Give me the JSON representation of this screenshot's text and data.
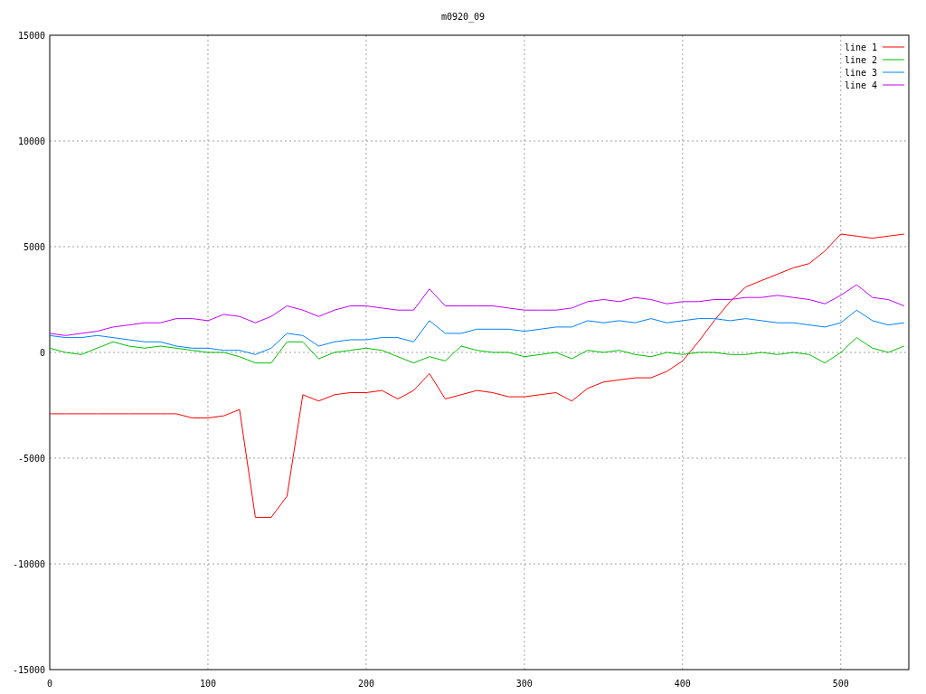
{
  "chart_data": {
    "type": "line",
    "title": "m0920_09",
    "x": [
      0,
      10,
      20,
      30,
      40,
      50,
      60,
      70,
      80,
      90,
      100,
      110,
      120,
      130,
      140,
      150,
      160,
      170,
      180,
      190,
      200,
      210,
      220,
      230,
      240,
      250,
      260,
      270,
      280,
      290,
      300,
      310,
      320,
      330,
      340,
      350,
      360,
      370,
      380,
      390,
      400,
      410,
      420,
      430,
      440,
      450,
      460,
      470,
      480,
      490,
      500,
      510,
      520,
      530,
      540
    ],
    "series": [
      {
        "name": "line 1",
        "color": "#ff0000",
        "values": [
          -2900,
          -2900,
          -2900,
          -2900,
          -2900,
          -2900,
          -2900,
          -2900,
          -2900,
          -3100,
          -3100,
          -3000,
          -2700,
          -7800,
          -7800,
          -6800,
          -2000,
          -2300,
          -2000,
          -1900,
          -1900,
          -1800,
          -2200,
          -1800,
          -1000,
          -2200,
          -2000,
          -1800,
          -1900,
          -2100,
          -2100,
          -2000,
          -1900,
          -2300,
          -1700,
          -1400,
          -1300,
          -1200,
          -1200,
          -900,
          -400,
          500,
          1500,
          2400,
          3100,
          3400,
          3700,
          4000,
          4200,
          4800,
          5600,
          5500,
          5400,
          5500,
          5600
        ]
      },
      {
        "name": "line 2",
        "color": "#00c000",
        "values": [
          200,
          0,
          -100,
          200,
          500,
          300,
          200,
          300,
          200,
          100,
          0,
          0,
          -200,
          -500,
          -500,
          500,
          500,
          -300,
          0,
          100,
          200,
          100,
          -200,
          -500,
          -200,
          -400,
          300,
          100,
          0,
          0,
          -200,
          -100,
          0,
          -300,
          100,
          0,
          100,
          -100,
          -200,
          0,
          -100,
          0,
          0,
          -100,
          -100,
          0,
          -100,
          0,
          -100,
          -500,
          0,
          700,
          200,
          0,
          300
        ]
      },
      {
        "name": "line 3",
        "color": "#0080ff",
        "values": [
          800,
          700,
          700,
          800,
          700,
          600,
          500,
          500,
          300,
          200,
          200,
          100,
          100,
          -100,
          200,
          900,
          800,
          300,
          500,
          600,
          600,
          700,
          700,
          500,
          1500,
          900,
          900,
          1100,
          1100,
          1100,
          1000,
          1100,
          1200,
          1200,
          1500,
          1400,
          1500,
          1400,
          1600,
          1400,
          1500,
          1600,
          1600,
          1500,
          1600,
          1500,
          1400,
          1400,
          1300,
          1200,
          1400,
          2000,
          1500,
          1300,
          1400
        ]
      },
      {
        "name": "line 4",
        "color": "#c000ff",
        "values": [
          900,
          800,
          900,
          1000,
          1200,
          1300,
          1400,
          1400,
          1600,
          1600,
          1500,
          1800,
          1700,
          1400,
          1700,
          2200,
          2000,
          1700,
          2000,
          2200,
          2200,
          2100,
          2000,
          2000,
          3000,
          2200,
          2200,
          2200,
          2200,
          2100,
          2000,
          2000,
          2000,
          2100,
          2400,
          2500,
          2400,
          2600,
          2500,
          2300,
          2400,
          2400,
          2500,
          2500,
          2600,
          2600,
          2700,
          2600,
          2500,
          2300,
          2700,
          3200,
          2600,
          2500,
          2200
        ]
      }
    ],
    "grid": true,
    "legend": true,
    "xlim": [
      0,
      543
    ],
    "ylim": [
      -15000,
      15000
    ],
    "xticks": [
      0,
      100,
      200,
      300,
      400,
      500
    ],
    "yticks": [
      -15000,
      -10000,
      -5000,
      0,
      5000,
      10000,
      15000
    ]
  }
}
